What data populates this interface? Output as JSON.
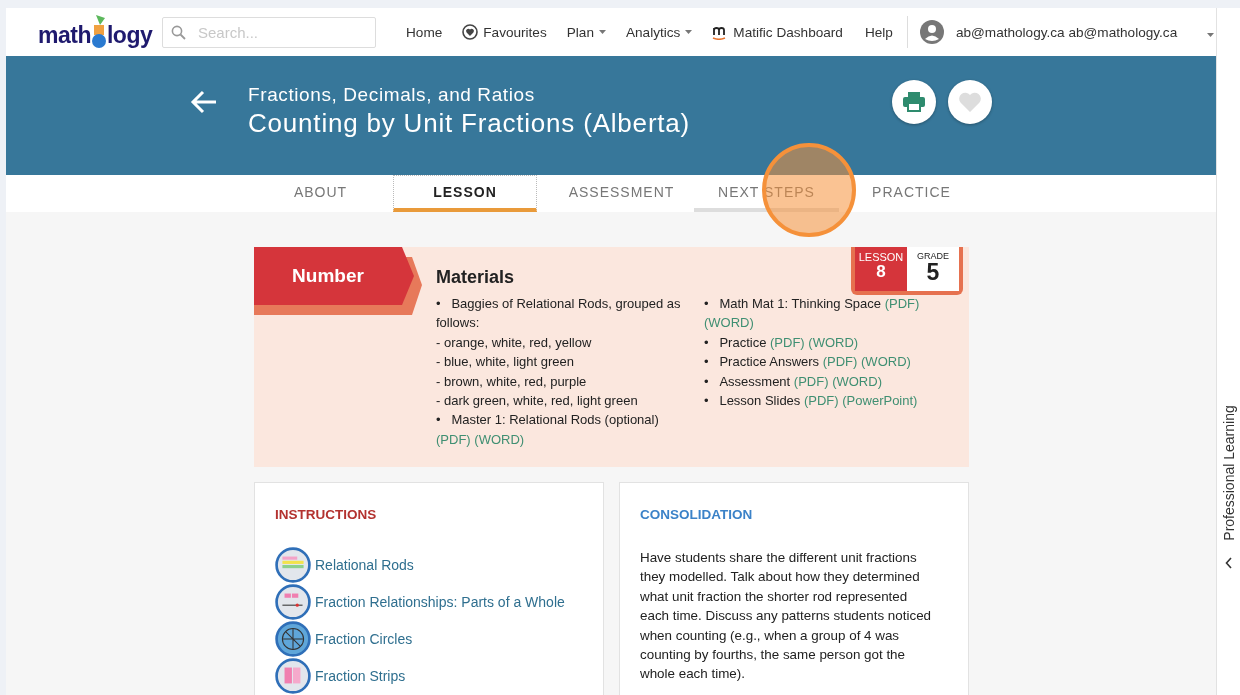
{
  "navbar": {
    "logo": {
      "before": "math",
      "after": "logy"
    },
    "search": {
      "placeholder": "Search..."
    },
    "items": [
      {
        "label": "Home",
        "kind": "link"
      },
      {
        "label": "Favourites",
        "kind": "favourites"
      },
      {
        "label": "Plan",
        "kind": "dropdown"
      },
      {
        "label": "Analytics",
        "kind": "dropdown"
      },
      {
        "label": "Matific Dashboard",
        "kind": "matific"
      },
      {
        "label": "Help",
        "kind": "link"
      }
    ],
    "user": {
      "email": "ab@mathology.ca ab@mathology.ca"
    }
  },
  "banner": {
    "subtitle": "Fractions, Decimals, and Ratios",
    "title": "Counting by Unit Fractions (Alberta)"
  },
  "tabs": [
    {
      "label": "ABOUT",
      "selected": false,
      "hovered": false
    },
    {
      "label": "LESSON",
      "selected": true,
      "hovered": false
    },
    {
      "label": "ASSESSMENT",
      "selected": false,
      "hovered": false
    },
    {
      "label": "NEXT STEPS",
      "selected": false,
      "hovered": true
    },
    {
      "label": "PRACTICE",
      "selected": false,
      "hovered": false
    }
  ],
  "materials": {
    "strand": "Number",
    "lesson_label": "LESSON",
    "lesson": "8",
    "grade_label": "GRADE",
    "grade": "5",
    "title": "Materials",
    "columns": [
      [
        {
          "bullet": "•",
          "text": "Baggies of Relational Rods, grouped as follows:"
        },
        {
          "text": "- orange, white, red, yellow"
        },
        {
          "text": "- blue, white, light green"
        },
        {
          "text": "- brown, white, red, purple"
        },
        {
          "text": "- dark green, white, red, light green"
        },
        {
          "bullet": "•",
          "text": "Master 1: Relational Rods (optional)",
          "links": [
            "(PDF)",
            "(WORD)"
          ]
        }
      ],
      [
        {
          "bullet": "•",
          "text": "Math Mat 1: Thinking Space",
          "links": [
            "(PDF)",
            "(WORD)"
          ]
        },
        {
          "bullet": "•",
          "text": "Practice",
          "links": [
            "(PDF)",
            "(WORD)"
          ]
        },
        {
          "bullet": "•",
          "text": "Practice Answers",
          "links": [
            "(PDF)",
            "(WORD)"
          ]
        },
        {
          "bullet": "•",
          "text": "Assessment",
          "links": [
            "(PDF)",
            "(WORD)"
          ]
        },
        {
          "bullet": "•",
          "text": "Lesson Slides",
          "links": [
            "(PDF)",
            "(PowerPoint)"
          ]
        }
      ]
    ]
  },
  "instructions": {
    "title": "INSTRUCTIONS",
    "items": [
      {
        "label": "Relational Rods",
        "kind": "rods"
      },
      {
        "label": "Fraction Relationships: Parts of a Whole",
        "kind": "parts"
      },
      {
        "label": "Fraction Circles",
        "kind": "circles"
      },
      {
        "label": "Fraction Strips",
        "kind": "strips"
      }
    ]
  },
  "consolidation": {
    "title": "CONSOLIDATION",
    "text": "Have students share the different unit fractions they modelled. Talk about how they determined what unit fraction the shorter rod represented each time. Discuss any patterns students noticed when counting (e.g., when a group of 4 was counting by fourths, the same person got the whole each time)."
  },
  "side_tab": {
    "label": "Professional Learning"
  }
}
